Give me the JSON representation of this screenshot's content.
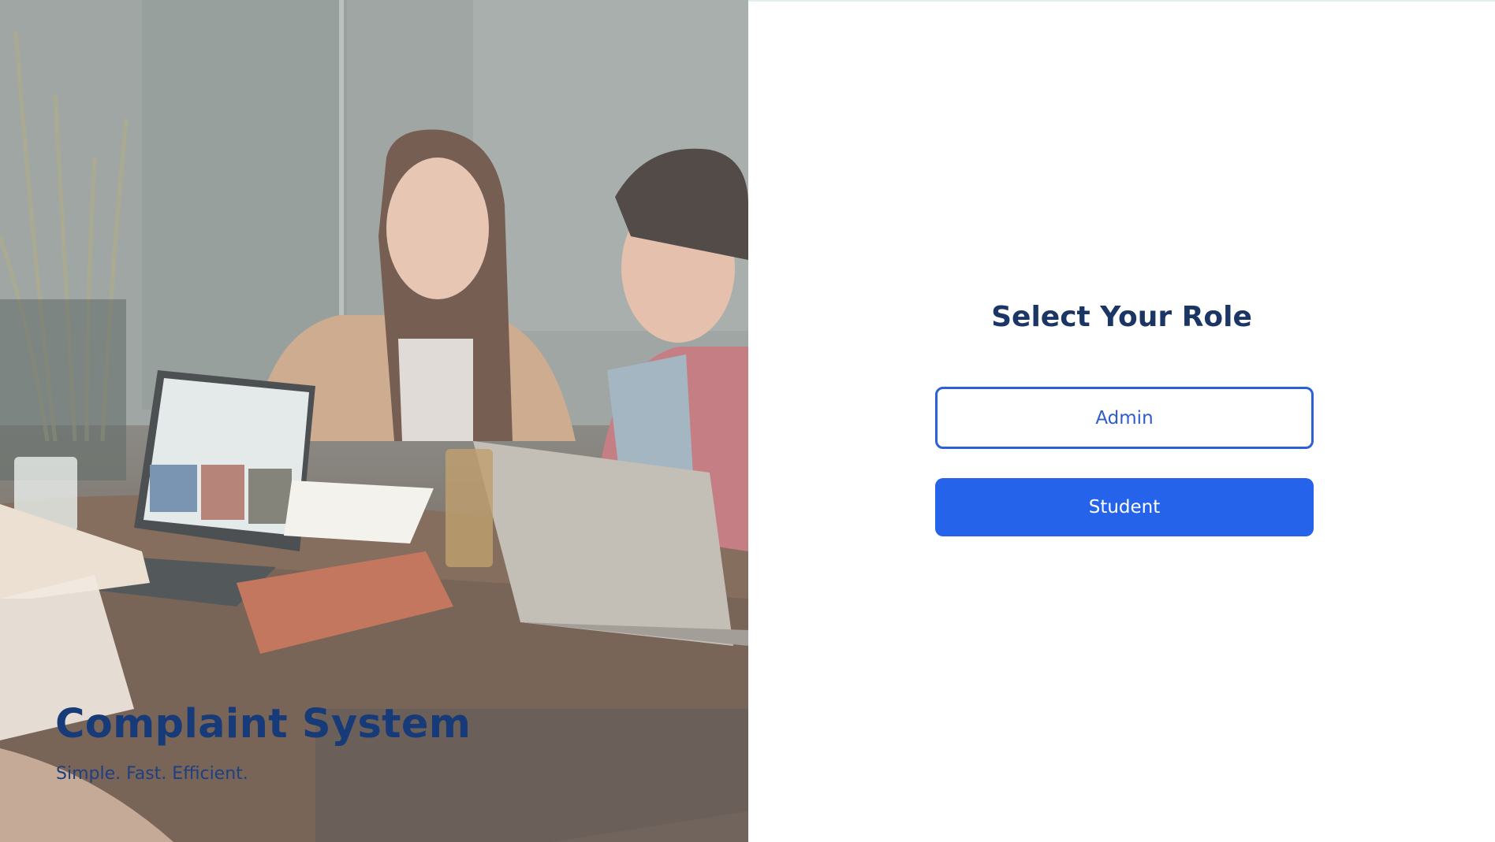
{
  "brand": {
    "title": "Complaint System",
    "tagline": "Simple. Fast. Efficient."
  },
  "role_select": {
    "title": "Select Your Role",
    "options": [
      {
        "label": "Admin",
        "style": "outline"
      },
      {
        "label": "Student",
        "style": "solid"
      }
    ]
  },
  "colors": {
    "primary": "#2563eb",
    "heading": "#1b3565",
    "brand_text": "#173a78"
  }
}
